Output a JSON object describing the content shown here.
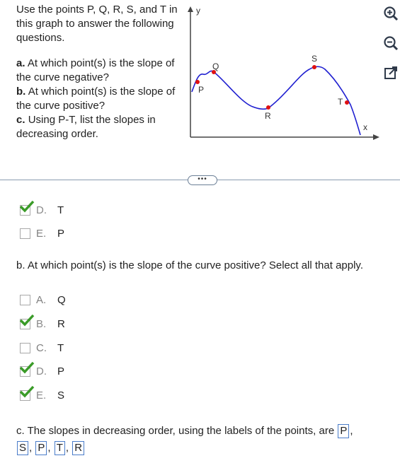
{
  "intro": "Use the points P, Q, R, S, and T in this graph to answer the following questions.",
  "questions": {
    "a": {
      "label": "a.",
      "text": "At which point(s) is the slope of the curve negative?"
    },
    "b": {
      "label": "b.",
      "text": "At which point(s) is the slope of the curve positive?"
    },
    "c": {
      "label": "c.",
      "text": "Using P-T, list the slopes in decreasing order."
    }
  },
  "graph": {
    "y_label": "y",
    "x_label": "x",
    "points": [
      "P",
      "Q",
      "R",
      "S",
      "T"
    ]
  },
  "toolbar": {
    "zoom_in_icon": "zoom-in-icon",
    "zoom_out_icon": "zoom-out-icon",
    "popout_icon": "popout-icon"
  },
  "expand_label": "•••",
  "part_a_options": [
    {
      "letter": "D.",
      "value": "T",
      "checked": true
    },
    {
      "letter": "E.",
      "value": "P",
      "checked": false
    }
  ],
  "part_b": {
    "question": "b. At which point(s) is the slope of the curve positive? Select all that apply.",
    "options": [
      {
        "letter": "A.",
        "value": "Q",
        "checked": false
      },
      {
        "letter": "B.",
        "value": "R",
        "checked": true
      },
      {
        "letter": "C.",
        "value": "T",
        "checked": false
      },
      {
        "letter": "D.",
        "value": "P",
        "checked": true
      },
      {
        "letter": "E.",
        "value": "S",
        "checked": true
      }
    ]
  },
  "part_c": {
    "prefix": "c. The slopes in decreasing order, using the labels of the points, are",
    "answers": [
      "P",
      "S",
      "P",
      "T",
      "R"
    ],
    "sep": ","
  },
  "colors": {
    "curve": "#1f1fd0",
    "point": "#e01010",
    "check": "#3a9b28",
    "answer_border": "#4a7cc9"
  }
}
